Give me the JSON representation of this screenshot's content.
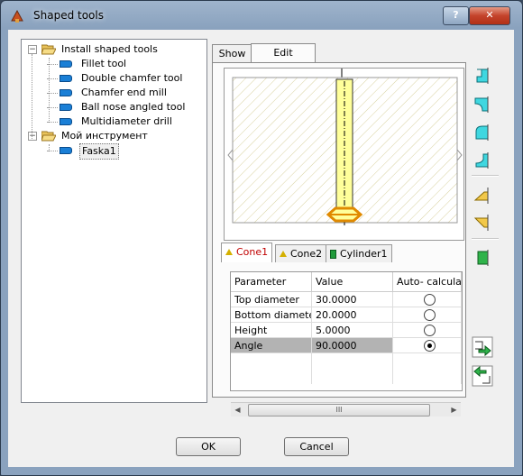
{
  "window": {
    "title": "Shaped tools",
    "help_label": "?",
    "close_label": "✕"
  },
  "tree": [
    {
      "label": "Install shaped tools",
      "type": "folder",
      "level": 0,
      "expanded": true
    },
    {
      "label": "Fillet tool",
      "type": "tool",
      "level": 1
    },
    {
      "label": "Double chamfer tool",
      "type": "tool",
      "level": 1
    },
    {
      "label": "Chamfer end mill",
      "type": "tool",
      "level": 1
    },
    {
      "label": "Ball nose angled tool",
      "type": "tool",
      "level": 1
    },
    {
      "label": "Multidiameter drill",
      "type": "tool",
      "level": 1
    },
    {
      "label": "Мой инструмент",
      "type": "folder",
      "level": 0,
      "expanded": true
    },
    {
      "label": "Faska1",
      "type": "tool",
      "level": 1,
      "selected": true
    }
  ],
  "tabs": [
    {
      "label": "Show"
    },
    {
      "label": "Edit"
    }
  ],
  "segment_tabs": [
    {
      "label": "Cone1",
      "icon": "cone-icon",
      "active": true
    },
    {
      "label": "Cone2",
      "icon": "cone-icon"
    },
    {
      "label": "Cylinder1",
      "icon": "cylinder-icon"
    }
  ],
  "grid": {
    "headers": [
      "Parameter",
      "Value",
      "Auto- calculat"
    ],
    "rows": [
      {
        "parameter": "Top diameter",
        "value": "30.0000",
        "auto": false
      },
      {
        "parameter": "Bottom diameter",
        "value": "20.0000",
        "auto": false
      },
      {
        "parameter": "Height",
        "value": "5.0000",
        "auto": false
      },
      {
        "parameter": "Angle",
        "value": "90.0000",
        "auto": true,
        "selected": true
      }
    ]
  },
  "scrollbar": {
    "left": "◀",
    "right": "▶",
    "thumb": "III"
  },
  "buttons": {
    "ok": "OK",
    "cancel": "Cancel"
  },
  "colors": {
    "segment_fill": "#ffff9a",
    "segment_outline": "#e08a00",
    "side_cyan": "#3fd7e0",
    "side_yellow": "#f2c84a",
    "side_green": "#2fb34a"
  }
}
